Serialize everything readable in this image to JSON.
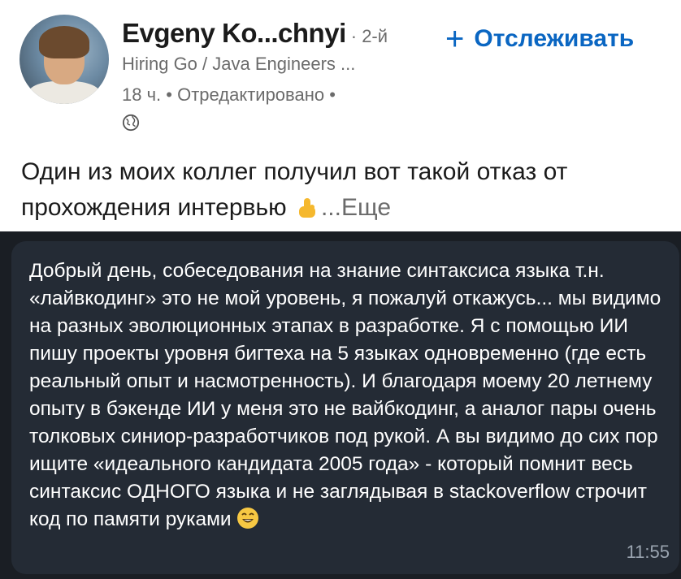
{
  "author": {
    "name": "Evgeny Ko...chnyi",
    "degree": "· 2-й",
    "headline": "Hiring Go / Java Engineers ...",
    "meta": "18 ч. • Отредактировано •"
  },
  "follow_label": "Отслеживать",
  "post": {
    "text_line1": "Один из моих коллег получил вот такой отказ от",
    "text_line2": "прохождения интервью",
    "more_label": "...Еще"
  },
  "message": {
    "text": "Добрый день, собеседования на знание синтаксиса языка т.н. «лайвкодинг» это не мой уровень, я пожалуй откажусь... мы видимо на разных эволюционных этапах в разработке. Я с помощью ИИ пишу проекты уровня бигтеха на 5 языках одновременно (где есть реальный опыт и насмотренность). И благодаря моему 20 летнему опыту в бэкенде ИИ у меня это не вайбкодинг, а аналог пары очень толковых синиор-разработчиков под рукой. А вы видимо до сих пор ищите «идеального кандидата 2005 года» - который помнит весь синтаксис ОДНОГО языка и не заглядывая в stackoverflow строчит код по памяти руками",
    "time": "11:55"
  },
  "colors": {
    "link": "#0a66c2",
    "chat_bg": "#1a1e24",
    "bubble_bg": "#242b35"
  },
  "icons": [
    "globe-icon",
    "point-down-emoji",
    "smile-emoji",
    "plus-icon"
  ]
}
